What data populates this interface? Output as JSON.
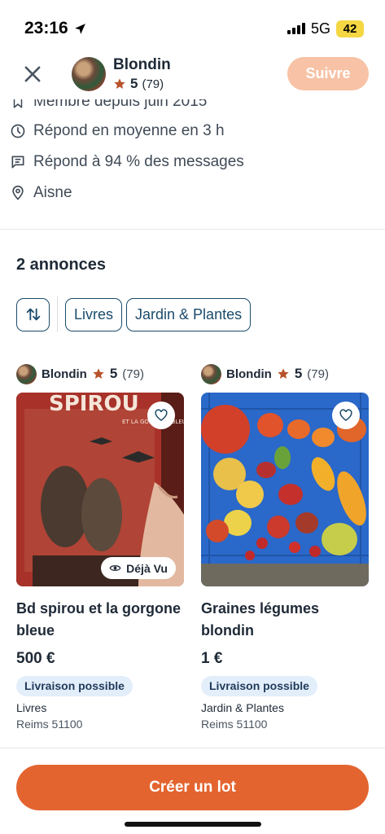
{
  "status_bar": {
    "time": "23:16",
    "network": "5G",
    "battery": "42"
  },
  "header": {
    "seller_name": "Blondin",
    "rating": "5",
    "rating_count": "(79)",
    "follow_label": "Suivre"
  },
  "info": [
    {
      "icon": "bookmark-icon",
      "text": "Membre depuis juin 2015"
    },
    {
      "icon": "clock-icon",
      "text": "Répond en moyenne en 3 h"
    },
    {
      "icon": "message-icon",
      "text": "Répond à 94 % des messages"
    },
    {
      "icon": "location-pin-icon",
      "text": "Aisne"
    }
  ],
  "listings": {
    "title": "2 annonces",
    "filters": [
      "Livres",
      "Jardin & Plantes"
    ]
  },
  "cards": [
    {
      "seller": "Blondin",
      "rating": "5",
      "rating_count": "(79)",
      "image_text": "SPIROU",
      "image_subtext": "ET LA GORGONE BLEUE",
      "badge": "Déjà Vu",
      "title": "Bd spirou et la gorgone bleue",
      "price": "500 €",
      "delivery": "Livraison possible",
      "category": "Livres",
      "location": "Reims 51100"
    },
    {
      "seller": "Blondin",
      "rating": "5",
      "rating_count": "(79)",
      "title": "Graines légumes blondin",
      "price": "1 €",
      "delivery": "Livraison possible",
      "category": "Jardin & Plantes",
      "location": "Reims 51100"
    }
  ],
  "cta": {
    "label": "Créer un lot"
  },
  "colors": {
    "accent": "#e4642f",
    "follow": "#f7c2a5",
    "star": "#b8522a",
    "outline": "#1b4b6b"
  }
}
